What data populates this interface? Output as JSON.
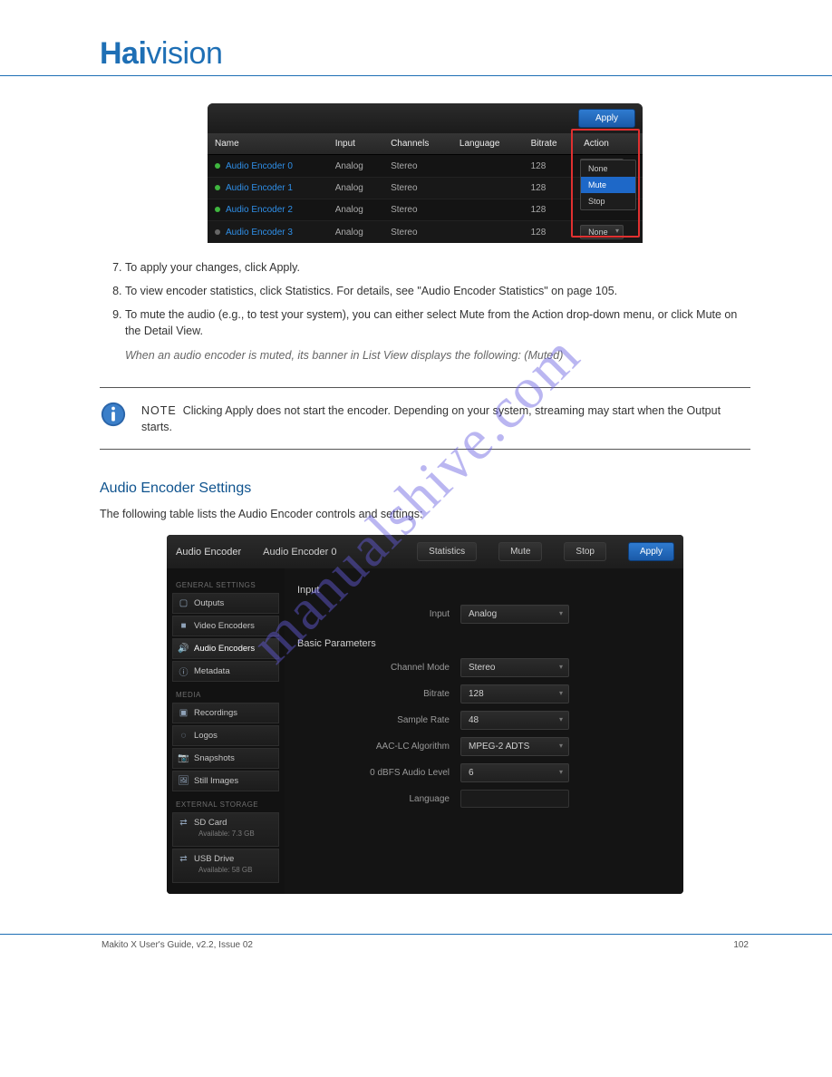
{
  "brand": {
    "part1": "Hai",
    "part2": "vision"
  },
  "shot1": {
    "apply": "Apply",
    "headers": {
      "name": "Name",
      "input": "Input",
      "channels": "Channels",
      "language": "Language",
      "bitrate": "Bitrate",
      "action": "Action"
    },
    "rows": [
      {
        "name": "Audio Encoder 0",
        "input": "Analog",
        "channels": "Stereo",
        "bitrate": "128",
        "action": "None",
        "status": "green"
      },
      {
        "name": "Audio Encoder 1",
        "input": "Analog",
        "channels": "Stereo",
        "bitrate": "128",
        "action": "None",
        "status": "green"
      },
      {
        "name": "Audio Encoder 2",
        "input": "Analog",
        "channels": "Stereo",
        "bitrate": "128",
        "action": "None",
        "status": "green"
      },
      {
        "name": "Audio Encoder 3",
        "input": "Analog",
        "channels": "Stereo",
        "bitrate": "128",
        "action": "None",
        "status": "gray"
      }
    ],
    "dropdown": {
      "opt1": "None",
      "opt2": "Mute",
      "opt3": "Stop"
    }
  },
  "body": {
    "step7": "To apply your changes, click Apply.",
    "step8": "To view encoder statistics, click Statistics. For details, see \"Audio Encoder Statistics\" on page 105.",
    "step9a": "To mute the audio (e.g., to test your system), you can either select Mute from the Action drop-down menu, or click Mute on the Detail View.",
    "step9b": "When an audio encoder is muted, its banner in List View displays the following: (Muted)"
  },
  "note": {
    "label": "NOTE",
    "text": "Clicking Apply does not start the encoder. Depending on your system, streaming may start when the Output starts."
  },
  "section_title": "Audio Encoder Settings",
  "intro": "The following table lists the Audio Encoder controls and settings:",
  "shot2": {
    "title1": "Audio Encoder",
    "title2": "Audio Encoder 0",
    "buttons": {
      "stats": "Statistics",
      "mute": "Mute",
      "stop": "Stop",
      "apply": "Apply"
    },
    "side": {
      "general_header": "GENERAL SETTINGS",
      "outputs": "Outputs",
      "video": "Video Encoders",
      "audio": "Audio Encoders",
      "meta": "Metadata",
      "media_header": "MEDIA",
      "recordings": "Recordings",
      "logos": "Logos",
      "snapshots": "Snapshots",
      "still": "Still Images",
      "ext_header": "EXTERNAL STORAGE",
      "sd": "SD Card",
      "sd_sub": "Available: 7.3 GB",
      "usb": "USB Drive",
      "usb_sub": "Available: 58 GB"
    },
    "main": {
      "input_head": "Input",
      "input_label": "Input",
      "input_val": "Analog",
      "basic_head": "Basic Parameters",
      "ch_label": "Channel Mode",
      "ch_val": "Stereo",
      "br_label": "Bitrate",
      "br_val": "128",
      "sr_label": "Sample Rate",
      "sr_val": "48",
      "aac_label": "AAC-LC Algorithm",
      "aac_val": "MPEG-2 ADTS",
      "lvl_label": "0 dBFS Audio Level",
      "lvl_val": "6",
      "lang_label": "Language"
    }
  },
  "footer": {
    "text": "Makito X User's Guide, v2.2, Issue 02",
    "page": "102"
  },
  "watermark": "manualshive.com"
}
